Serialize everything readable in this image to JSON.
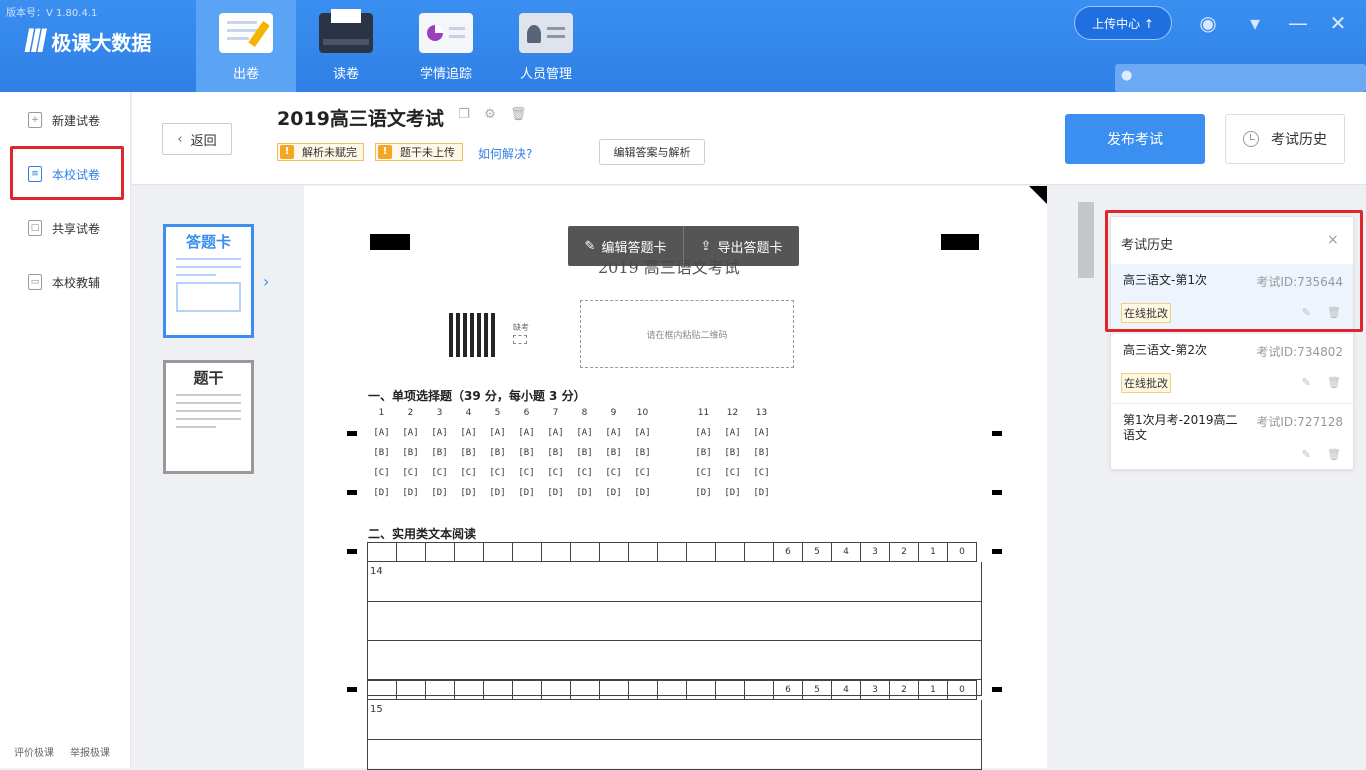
{
  "app": {
    "version": "版本号：V 1.80.4.1",
    "logo_mark": "III",
    "logo_text": "极课大数据"
  },
  "nav": {
    "tabs": [
      {
        "label": "出卷",
        "active": true
      },
      {
        "label": "读卷"
      },
      {
        "label": "学情追踪"
      },
      {
        "label": "人员管理"
      }
    ],
    "upload": "上传中心 ↑",
    "icons": [
      "headset-icon",
      "dropdown-icon",
      "minimize-icon",
      "close-icon"
    ]
  },
  "sidebar": {
    "items": [
      {
        "label": "新建试卷",
        "icon": "+"
      },
      {
        "label": "本校试卷",
        "icon": "≡",
        "active": true
      },
      {
        "label": "共享试卷",
        "icon": "□"
      },
      {
        "label": "本校教辅",
        "icon": "▭"
      }
    ],
    "footer": [
      "评价极课",
      "举报极课"
    ]
  },
  "header": {
    "back": "返回",
    "title": "2019高三语文考试",
    "warnings": [
      "解析未赋完",
      "题干未上传"
    ],
    "how": "如何解决?",
    "edit_answers": "编辑答案与解析",
    "publish": "发布考试",
    "history": "考试历史"
  },
  "thumbs": [
    "答题卡",
    "题干"
  ],
  "paper": {
    "toolbar": [
      "编辑答题卡",
      "导出答题卡"
    ],
    "title": "2019 高三语文考试",
    "absent": "缺考",
    "paste": "请在框内粘贴二维码",
    "section1": "一、单项选择题（39 分，每小题 3 分）",
    "qnums_a": [
      "1",
      "2",
      "3",
      "4",
      "5",
      "6",
      "7",
      "8",
      "9",
      "10"
    ],
    "qnums_b": [
      "11",
      "12",
      "13"
    ],
    "options": [
      "[A]",
      "[B]",
      "[C]",
      "[D]"
    ],
    "section2": "二、实用类文本阅读",
    "scores": [
      "6",
      "5",
      "4",
      "3",
      "2",
      "1",
      "0"
    ],
    "q14": "14",
    "q15": "15"
  },
  "history": {
    "title": "考试历史",
    "close": "×",
    "items": [
      {
        "name": "高三语文-第1次",
        "id": "考试ID:735644",
        "tag": "在线批改",
        "selected": true
      },
      {
        "name": "高三语文-第2次",
        "id": "考试ID:734802",
        "tag": "在线批改"
      },
      {
        "name": "第1次月考-2019高二语文",
        "id": "考试ID:727128",
        "tag": ""
      }
    ]
  },
  "colors": {
    "primary": "#3a8ff0",
    "highlight": "#e0262d",
    "warn": "#f5a623"
  }
}
